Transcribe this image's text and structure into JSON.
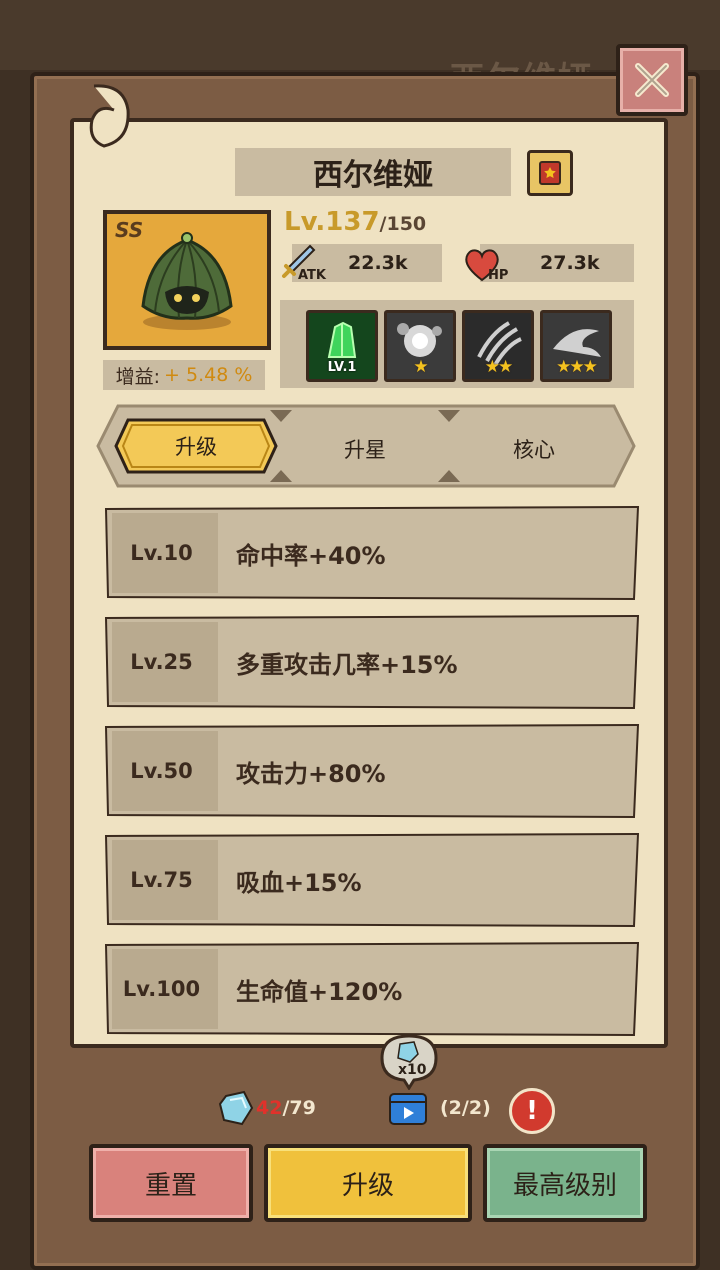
{
  "background": {
    "ghost_title": "西尔维娅"
  },
  "hero": {
    "name": "西尔维娅",
    "rank": "SS",
    "level_current": "Lv.137",
    "level_max": "/150",
    "gain_label": "增益:",
    "gain_value": "+ 5.48 %",
    "atk_tag": "ATK",
    "atk_value": "22.3k",
    "hp_tag": "HP",
    "hp_value": "27.3k"
  },
  "skills": [
    {
      "icon": "green-crystal-skill-icon",
      "label": "LV.1",
      "stars": ""
    },
    {
      "icon": "explosion-skill-icon",
      "label": "",
      "stars": "★"
    },
    {
      "icon": "claw-skill-icon",
      "label": "",
      "stars": "★★"
    },
    {
      "icon": "storm-skill-icon",
      "label": "",
      "stars": "★★★"
    }
  ],
  "tabs": {
    "upgrade": "升级",
    "star": "升星",
    "core": "核心",
    "active": "upgrade"
  },
  "rows": [
    {
      "level": "Lv.10",
      "bonus": "命中率+40%"
    },
    {
      "level": "Lv.25",
      "bonus": "多重攻击几率+15%"
    },
    {
      "level": "Lv.50",
      "bonus": "攻击力+80%"
    },
    {
      "level": "Lv.75",
      "bonus": "吸血+15%"
    },
    {
      "level": "Lv.100",
      "bonus": "生命值+120%"
    }
  ],
  "resources": {
    "crystal_have": "42",
    "crystal_need": "/79",
    "video_bonus": "x10",
    "video_count": "(2/2)",
    "alert": "!"
  },
  "buttons": {
    "reset": "重置",
    "upgrade": "升级",
    "max_level": "最高级别"
  },
  "colors": {
    "paper": "#efe2c2",
    "frame": "#7c5c44",
    "gold": "#f0c13c",
    "red": "#d9827c",
    "green": "#7ab38c"
  }
}
